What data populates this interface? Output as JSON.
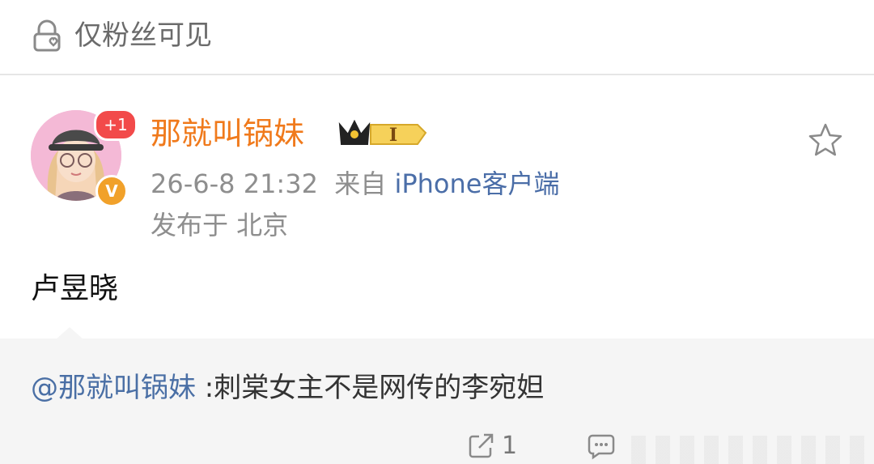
{
  "visibility": {
    "label": "仅粉丝可见",
    "icon": "lock-heart-icon"
  },
  "post": {
    "author": {
      "name": "那就叫锅妹",
      "follow_badge": "+1",
      "verified_mark": "V",
      "level_badge": "I"
    },
    "time": "26-6-8 21:32",
    "source_prefix": "来自",
    "device": "iPhone客户端",
    "location": "发布于 北京",
    "text": "卢昱晓"
  },
  "repost": {
    "mention": "@那就叫锅妹",
    "text": " :刺棠女主不是网传的李宛妲"
  },
  "actions": {
    "share_count": "1"
  },
  "colors": {
    "username": "#f07a1c",
    "link": "#4a6fa5",
    "meta": "#8e8e8e",
    "repost_bg": "#f5f5f5"
  }
}
